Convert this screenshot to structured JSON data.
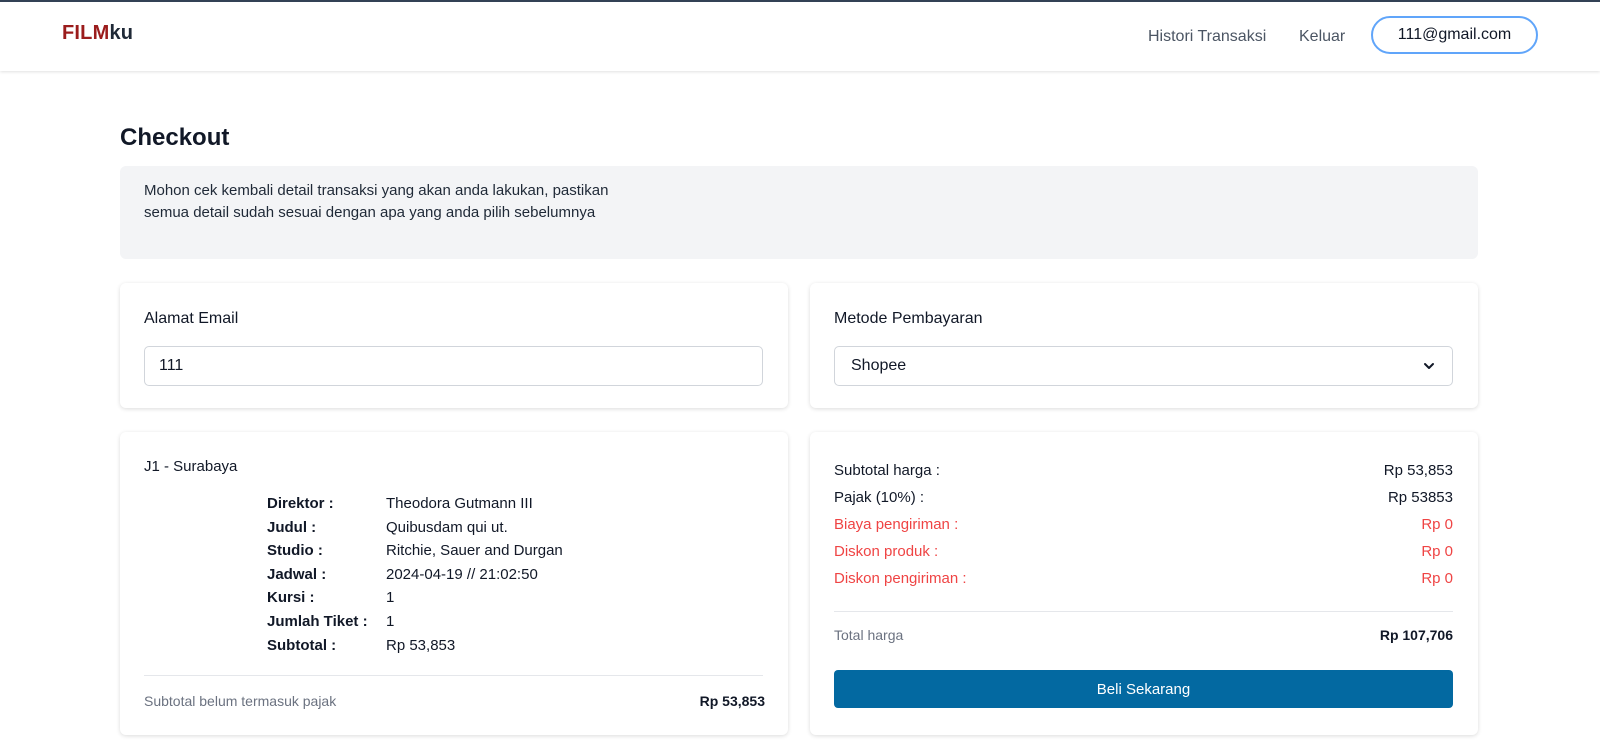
{
  "header": {
    "logo_part1": "FILM",
    "logo_part2": "ku",
    "nav_history": "Histori Transaksi",
    "nav_logout": "Keluar",
    "user_email": "111@gmail.com"
  },
  "page": {
    "title": "Checkout",
    "notice": "Mohon cek kembali detail transaksi yang akan anda lakukan, pastikan semua detail sudah sesuai dengan apa yang anda pilih sebelumnya"
  },
  "email_card": {
    "label": "Alamat Email",
    "value": "111"
  },
  "payment_card": {
    "label": "Metode Pembayaran",
    "selected": "Shopee"
  },
  "detail_card": {
    "studio": "J1 - Surabaya",
    "rows": [
      {
        "key": "Direktor :",
        "value": "Theodora Gutmann III"
      },
      {
        "key": "Judul :",
        "value": "Quibusdam qui ut."
      },
      {
        "key": "Studio :",
        "value": "Ritchie, Sauer and Durgan"
      },
      {
        "key": "Jadwal :",
        "value": "2024-04-19 // 21:02:50"
      },
      {
        "key": "Kursi :",
        "value": "1"
      },
      {
        "key": "Jumlah Tiket :",
        "value": "1"
      },
      {
        "key": "Subtotal :",
        "value": "Rp 53,853"
      }
    ],
    "footer_label": "Subtotal belum termasuk pajak",
    "footer_value": "Rp 53,853"
  },
  "summary_card": {
    "rows": [
      {
        "label": "Subtotal harga :",
        "value": "Rp 53,853"
      },
      {
        "label": "Pajak (10%) :",
        "value": "Rp 53853"
      },
      {
        "label": "Biaya pengiriman :",
        "value": "Rp 0"
      },
      {
        "label": "Diskon produk :",
        "value": "Rp 0"
      },
      {
        "label": "Diskon pengiriman :",
        "value": "Rp 0"
      }
    ],
    "total_label": "Total harga",
    "total_value": "Rp 107,706",
    "buy_label": "Beli Sekarang"
  },
  "colors": {
    "brand_red": "#9b1c1c",
    "primary_button": "#0369a1",
    "alert_red": "#ef4444",
    "pill_border": "#60a5fa"
  }
}
